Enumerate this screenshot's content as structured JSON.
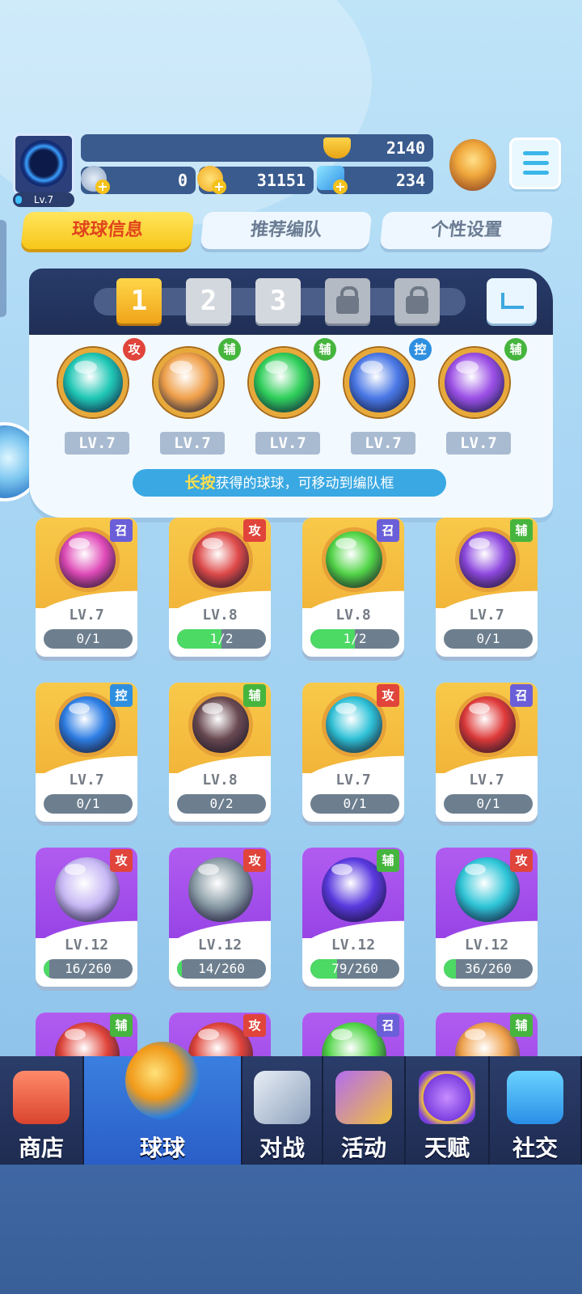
{
  "header": {
    "avatar_level": "Lv.7",
    "trophies": "2140",
    "stars": "0",
    "coins": "31151",
    "gems": "234"
  },
  "tabs": [
    {
      "label": "球球信息",
      "active": true
    },
    {
      "label": "推荐编队",
      "active": false
    },
    {
      "label": "个性设置",
      "active": false
    }
  ],
  "team": {
    "slots": [
      {
        "label": "1",
        "state": "selected"
      },
      {
        "label": "2",
        "state": "available"
      },
      {
        "label": "3",
        "state": "available"
      },
      {
        "label": "",
        "state": "locked",
        "icon": "lock-icon"
      },
      {
        "label": "",
        "state": "locked",
        "icon": "lock-icon"
      }
    ],
    "balls": [
      {
        "type": "攻",
        "level": "LV.7",
        "icon": "tornado-icon",
        "color": "#1fc7b5"
      },
      {
        "type": "辅",
        "level": "LV.7",
        "icon": "figures-icon",
        "color": "#f0a04a"
      },
      {
        "type": "辅",
        "level": "LV.7",
        "icon": "star-arrow-icon",
        "color": "#2fcf5a"
      },
      {
        "type": "控",
        "level": "LV.7",
        "icon": "clock-icon",
        "color": "#4a78e6"
      },
      {
        "type": "辅",
        "level": "LV.7",
        "icon": "leaf-icon",
        "color": "#9b4fe6"
      }
    ],
    "hint_key": "长按",
    "hint_rest": "获得的球球，可移动到编队框"
  },
  "collection": [
    {
      "type": "召",
      "level": "LV.7",
      "progress_text": "0/1",
      "progress": 0.0,
      "style": "gold",
      "icon": "feather-icon",
      "color": "#e04ab8"
    },
    {
      "type": "攻",
      "level": "LV.8",
      "progress_text": "1/2",
      "progress": 0.5,
      "style": "gold",
      "icon": "fist-icon",
      "color": "#e04a4a"
    },
    {
      "type": "召",
      "level": "LV.8",
      "progress_text": "1/2",
      "progress": 0.5,
      "style": "gold",
      "icon": "star-burst-icon",
      "color": "#52d648"
    },
    {
      "type": "辅",
      "level": "LV.7",
      "progress_text": "0/1",
      "progress": 0.0,
      "style": "gold",
      "icon": "leaf-icon",
      "color": "#8e48e0"
    },
    {
      "type": "控",
      "level": "LV.7",
      "progress_text": "0/1",
      "progress": 0.0,
      "style": "gold",
      "icon": "snowflake-icon",
      "color": "#2e7fe6"
    },
    {
      "type": "辅",
      "level": "LV.8",
      "progress_text": "0/2",
      "progress": 0.0,
      "style": "gold",
      "icon": "skull-icon",
      "color": "#6a4a52"
    },
    {
      "type": "攻",
      "level": "LV.7",
      "progress_text": "0/1",
      "progress": 0.0,
      "style": "gold",
      "icon": "swords-icon",
      "color": "#2ec2d8"
    },
    {
      "type": "召",
      "level": "LV.7",
      "progress_text": "0/1",
      "progress": 0.0,
      "style": "gold",
      "icon": "cannon-icon",
      "color": "#e03a3a"
    },
    {
      "type": "攻",
      "level": "LV.12",
      "progress_text": "16/260",
      "progress": 0.06,
      "style": "purple",
      "icon": "bubble-icon",
      "color": "#c7b8f5"
    },
    {
      "type": "攻",
      "level": "LV.12",
      "progress_text": "14/260",
      "progress": 0.05,
      "style": "purple",
      "icon": "vortex-icon",
      "color": "#8a9ca6"
    },
    {
      "type": "辅",
      "level": "LV.12",
      "progress_text": "79/260",
      "progress": 0.3,
      "style": "purple",
      "icon": "swap-arrow-icon",
      "color": "#5a3ae0"
    },
    {
      "type": "攻",
      "level": "LV.12",
      "progress_text": "36/260",
      "progress": 0.14,
      "style": "purple",
      "icon": "swirl-icon",
      "color": "#2ec6d8"
    },
    {
      "type": "辅",
      "level": "",
      "progress_text": "",
      "progress": 0,
      "style": "purple",
      "icon": "ball-icon",
      "color": "#e0443a"
    },
    {
      "type": "攻",
      "level": "",
      "progress_text": "",
      "progress": 0,
      "style": "purple",
      "icon": "ball-icon",
      "color": "#e0443a"
    },
    {
      "type": "召",
      "level": "",
      "progress_text": "",
      "progress": 0,
      "style": "purple",
      "icon": "ball-icon",
      "color": "#52d648"
    },
    {
      "type": "辅",
      "level": "",
      "progress_text": "",
      "progress": 0,
      "style": "purple",
      "icon": "ball-icon",
      "color": "#f0a04a"
    }
  ],
  "type_colors": {
    "攻": "#e0443a",
    "辅": "#46b53e",
    "控": "#2e8fe0",
    "召": "#6a5fd8"
  },
  "nav": [
    {
      "label": "商店",
      "icon": "shop-icon",
      "active": false
    },
    {
      "label": "球球",
      "icon": "balls-icon",
      "active": true
    },
    {
      "label": "对战",
      "icon": "crossed-swords-icon",
      "active": false
    },
    {
      "label": "活动",
      "icon": "party-popper-icon",
      "active": false
    },
    {
      "label": "天赋",
      "icon": "planet-icon",
      "active": false
    },
    {
      "label": "社交",
      "icon": "chat-heart-icon",
      "active": false
    }
  ]
}
